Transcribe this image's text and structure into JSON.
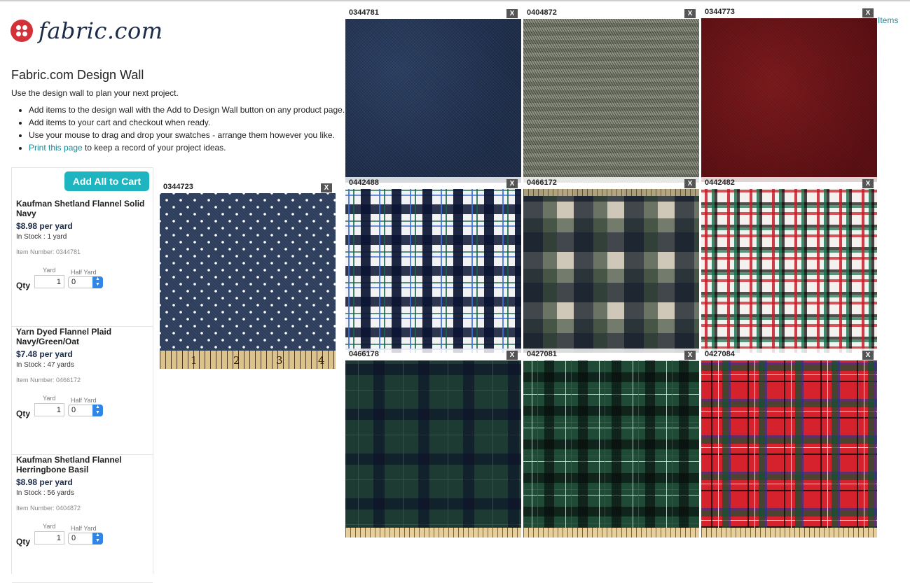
{
  "brand": {
    "logo_text": "fabric.com",
    "color": "#d2313a"
  },
  "page": {
    "title": "Fabric.com Design Wall",
    "intro": "Use the design wall to plan your next project.",
    "bullets": [
      "Add items to the design wall with the Add to Design Wall button on any product page.",
      "Add items to your cart and checkout when ready.",
      "Use your mouse to drag and drop your swatches - arrange them however you like."
    ],
    "print_link": "Print this page",
    "print_suffix": " to keep a record of your project ideas.",
    "items_link": "Items"
  },
  "cart": {
    "add_all_label": "Add All to Cart",
    "accent": "#1fb5c0",
    "qty_label": "Qty",
    "yard_label": "Yard",
    "half_yard_label": "Half Yard",
    "items": [
      {
        "name": "Kaufman Shetland Flannel Solid Navy",
        "price": "$8.98 per yard",
        "stock": "In Stock : 1 yard",
        "item_number": "Item Number: 0344781",
        "yard": "1",
        "half_yard": "0"
      },
      {
        "name": "Yarn Dyed Flannel Plaid Navy/Green/Oat",
        "price": "$7.48 per yard",
        "stock": "In Stock : 47 yards",
        "item_number": "Item Number: 0466172",
        "yard": "1",
        "half_yard": "0"
      },
      {
        "name": "Kaufman Shetland Flannel Herringbone Basil",
        "price": "$8.98 per yard",
        "stock": "In Stock : 56 yards",
        "item_number": "Item Number: 0404872",
        "yard": "1",
        "half_yard": "0"
      }
    ]
  },
  "swatches": [
    {
      "code": "0344781",
      "close": "X",
      "pattern": "navy solid"
    },
    {
      "code": "0404872",
      "close": "X",
      "pattern": "olive herringbone"
    },
    {
      "code": "0344773",
      "close": "X",
      "pattern": "red solid"
    },
    {
      "code": "0344723",
      "close": "X",
      "pattern": "navy pin dot",
      "ruler_numbers": [
        "1",
        "2",
        "3",
        "4"
      ]
    },
    {
      "code": "0442488",
      "close": "X",
      "pattern": "navy blue white plaid"
    },
    {
      "code": "0466172",
      "close": "X",
      "pattern": "navy green oat plaid"
    },
    {
      "code": "0442482",
      "close": "X",
      "pattern": "red white green plaid"
    },
    {
      "code": "0466178",
      "close": "X",
      "pattern": "black watch plaid"
    },
    {
      "code": "0427081",
      "close": "X",
      "pattern": "green tartan"
    },
    {
      "code": "0427084",
      "close": "X",
      "pattern": "red stewart tartan"
    }
  ]
}
